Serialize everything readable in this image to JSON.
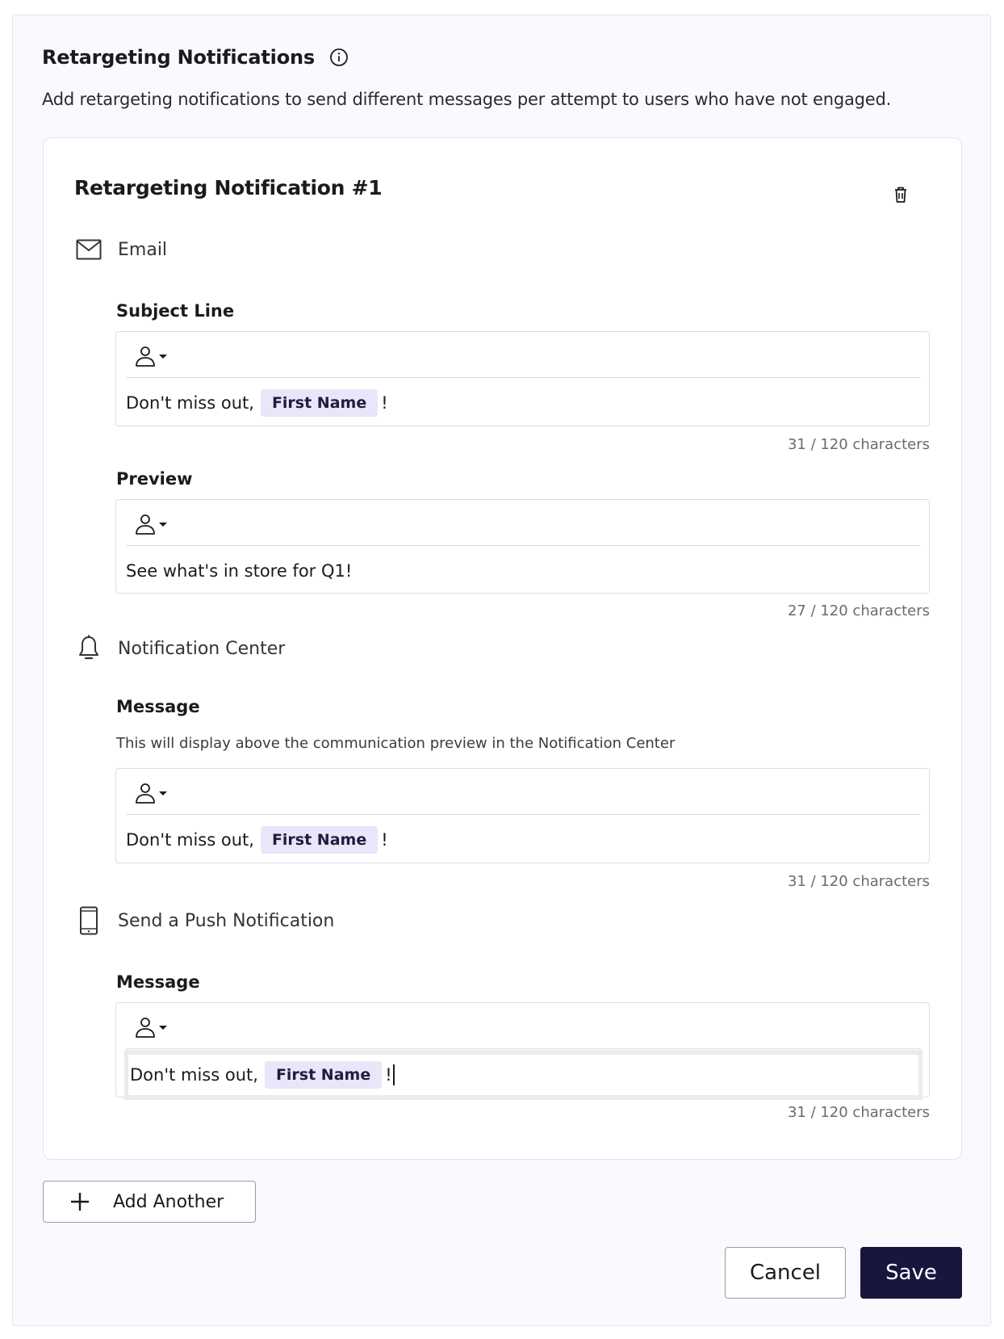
{
  "section": {
    "title": "Retargeting Notifications",
    "description": "Add retargeting notifications to send different messages per attempt to users who have not engaged."
  },
  "card": {
    "title": "Retargeting Notification #1"
  },
  "email": {
    "channel_label": "Email",
    "subject": {
      "label": "Subject Line",
      "text_before": "Don't miss out,",
      "token": "First Name",
      "text_after": "!",
      "counter": "31 / 120 characters"
    },
    "preview": {
      "label": "Preview",
      "text": "See what's in store for Q1!",
      "counter": "27 / 120 characters"
    }
  },
  "notification_center": {
    "channel_label": "Notification Center",
    "message": {
      "label": "Message",
      "helper": "This will display above the communication preview in the Notification Center",
      "text_before": "Don't miss out,",
      "token": "First Name",
      "text_after": "!",
      "counter": "31 / 120 characters"
    }
  },
  "push": {
    "channel_label": "Send a Push Notification",
    "message": {
      "label": "Message",
      "text_before": "Don't miss out,",
      "token": "First Name",
      "text_after": "!",
      "counter": "31 / 120 characters"
    }
  },
  "actions": {
    "add_another": "Add Another",
    "cancel": "Cancel",
    "save": "Save"
  },
  "icons": {
    "info": "info-icon",
    "trash": "trash-icon",
    "email": "envelope-icon",
    "notification_center": "bell-icon",
    "push": "phone-icon",
    "personalize": "person-dropdown-icon",
    "add": "plus-icon"
  },
  "colors": {
    "primary": "#17163d",
    "chip_bg": "#e8e6f8"
  }
}
